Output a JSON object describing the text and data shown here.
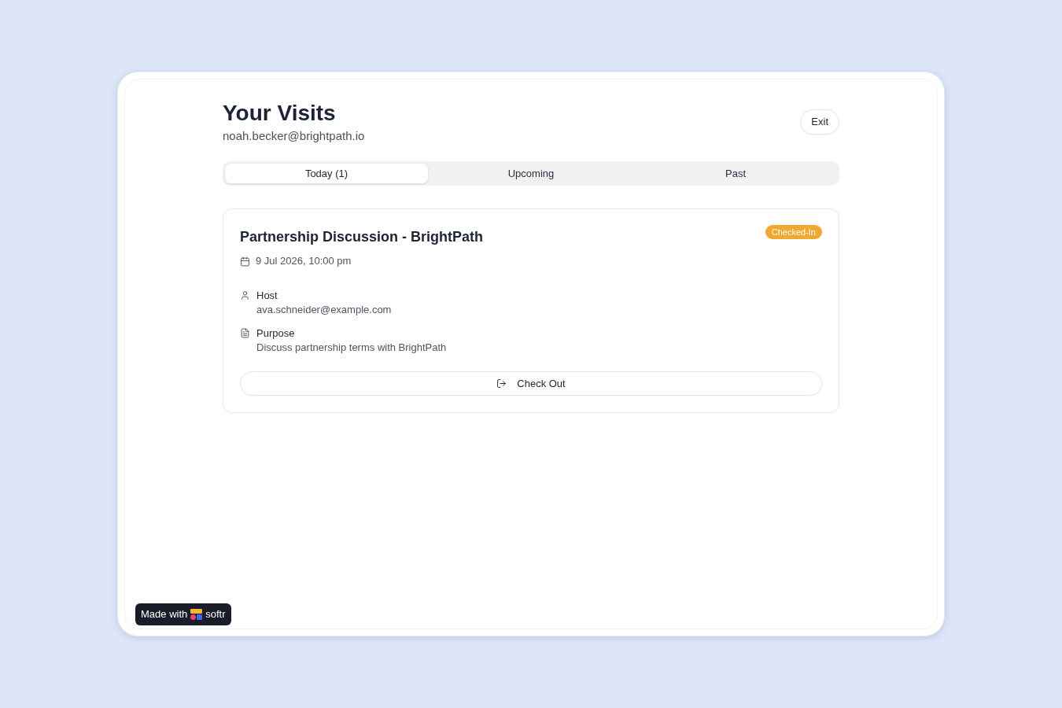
{
  "header": {
    "title": "Your Visits",
    "email": "noah.becker@brightpath.io",
    "exit_button": "Exit"
  },
  "tabs": [
    {
      "label": "Today (1)",
      "selected": true
    },
    {
      "label": "Upcoming",
      "selected": false
    },
    {
      "label": "Past",
      "selected": false
    }
  ],
  "visits": [
    {
      "title": "Partnership Discussion - BrightPath",
      "status": {
        "label": "Checked-In",
        "color": "#f0a830"
      },
      "datetime": "9 Jul 2026, 10:00 pm",
      "details": [
        {
          "kind": "host",
          "label": "Host",
          "value": "ava.schneider@example.com"
        },
        {
          "kind": "purpose",
          "label": "Purpose",
          "value": "Discuss partnership terms with BrightPath"
        }
      ],
      "action": "Check Out"
    }
  ],
  "badge": {
    "prefix": "Made with",
    "brand": "softr"
  }
}
